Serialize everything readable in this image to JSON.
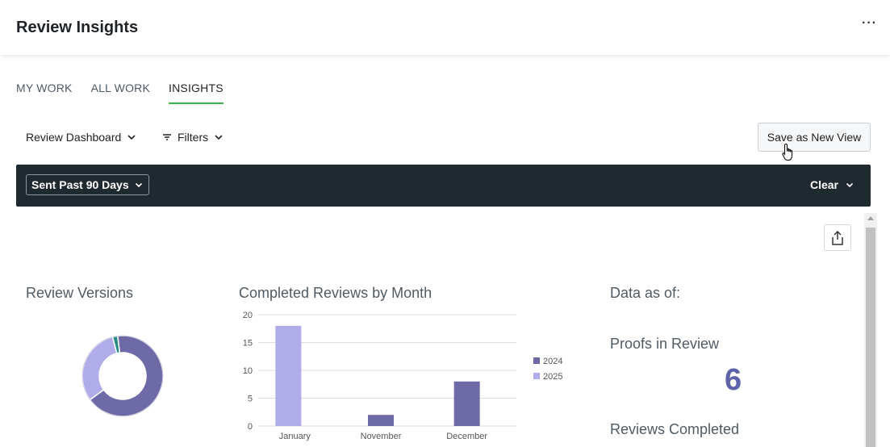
{
  "header": {
    "title": "Review Insights",
    "more_label": "···"
  },
  "tabs": [
    {
      "label": "MY WORK",
      "active": false
    },
    {
      "label": "ALL WORK",
      "active": false
    },
    {
      "label": "INSIGHTS",
      "active": true
    }
  ],
  "toolbar": {
    "dashboard_label": "Review Dashboard",
    "filters_label": "Filters",
    "save_view_label": "Save as New View"
  },
  "filterbar": {
    "chip_label": "Sent Past 90 Days",
    "clear_label": "Clear"
  },
  "colors": {
    "accent_tab": "#3ab54a",
    "series_2024": "#6e6aa8",
    "series_2025": "#b0acea",
    "donut_teal": "#2a8c86",
    "number": "#5e62a8"
  },
  "cards": {
    "review_versions_title": "Review Versions",
    "completed_title": "Completed Reviews by Month",
    "data_as_of": "Data as of:",
    "proofs_in_review_title": "Proofs in Review",
    "proofs_in_review_value": "6",
    "reviews_completed_title": "Reviews Completed"
  },
  "chart_data": [
    {
      "type": "pie",
      "title": "Review Versions",
      "slices": [
        {
          "value": 67,
          "color": "#6e6aa8"
        },
        {
          "value": 31,
          "color": "#b0acea"
        },
        {
          "value": 2,
          "color": "#2a8c86"
        }
      ],
      "donut": true
    },
    {
      "type": "bar",
      "title": "Completed Reviews by Month",
      "categories": [
        "January",
        "November",
        "December"
      ],
      "series": [
        {
          "name": "2024",
          "values": [
            0,
            2,
            8
          ],
          "color": "#6e6aa8"
        },
        {
          "name": "2025",
          "values": [
            18,
            0,
            0
          ],
          "color": "#b0acea"
        }
      ],
      "yticks": [
        0,
        5,
        10,
        15,
        20
      ],
      "ylim": [
        0,
        20
      ],
      "grid": true,
      "legend": "right"
    }
  ]
}
